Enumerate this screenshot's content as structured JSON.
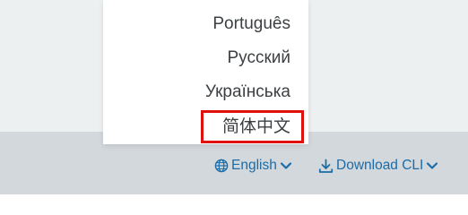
{
  "language_menu": {
    "items": [
      {
        "label": "Português"
      },
      {
        "label": "Русский"
      },
      {
        "label": "Українська"
      },
      {
        "label": "简体中文"
      }
    ],
    "highlighted_item": "简体中文",
    "highlight_color": "#e0100c"
  },
  "footer": {
    "language_selector": {
      "label": "English",
      "icon": "globe-icon",
      "chevron": "chevron-down-icon"
    },
    "download": {
      "label": "Download CLI",
      "icon": "download-icon",
      "chevron": "chevron-down-icon"
    },
    "link_color": "#1b6ca8",
    "background": "#d3d8dc"
  }
}
